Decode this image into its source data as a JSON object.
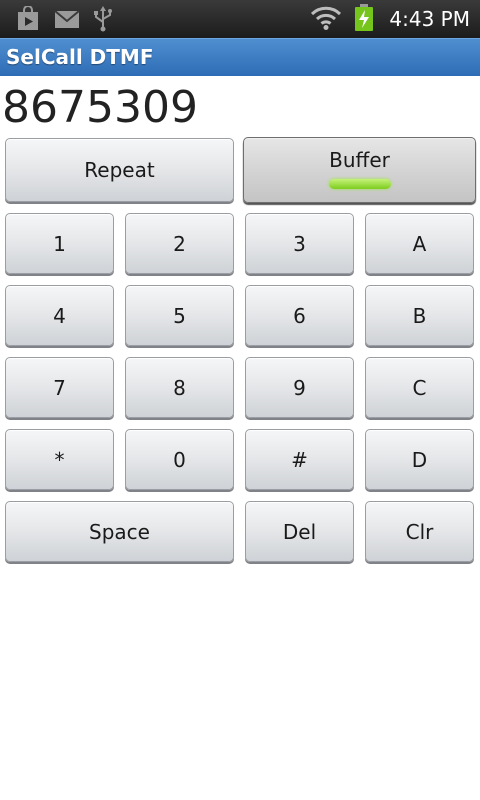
{
  "status_bar": {
    "icons": [
      "play-store-icon",
      "gmail-icon",
      "usb-icon",
      "wifi-icon",
      "battery-charging-icon"
    ],
    "time": "4:43 PM"
  },
  "app": {
    "title": "SelCall DTMF"
  },
  "display": {
    "value": "8675309"
  },
  "controls": {
    "repeat_label": "Repeat",
    "buffer_label": "Buffer",
    "buffer_on": true,
    "indicator_color": "#8fdc2a"
  },
  "keypad": {
    "keys": [
      "1",
      "2",
      "3",
      "A",
      "4",
      "5",
      "6",
      "B",
      "7",
      "8",
      "9",
      "C",
      "*",
      "0",
      "#",
      "D"
    ],
    "space_label": "Space",
    "del_label": "Del",
    "clr_label": "Clr"
  }
}
